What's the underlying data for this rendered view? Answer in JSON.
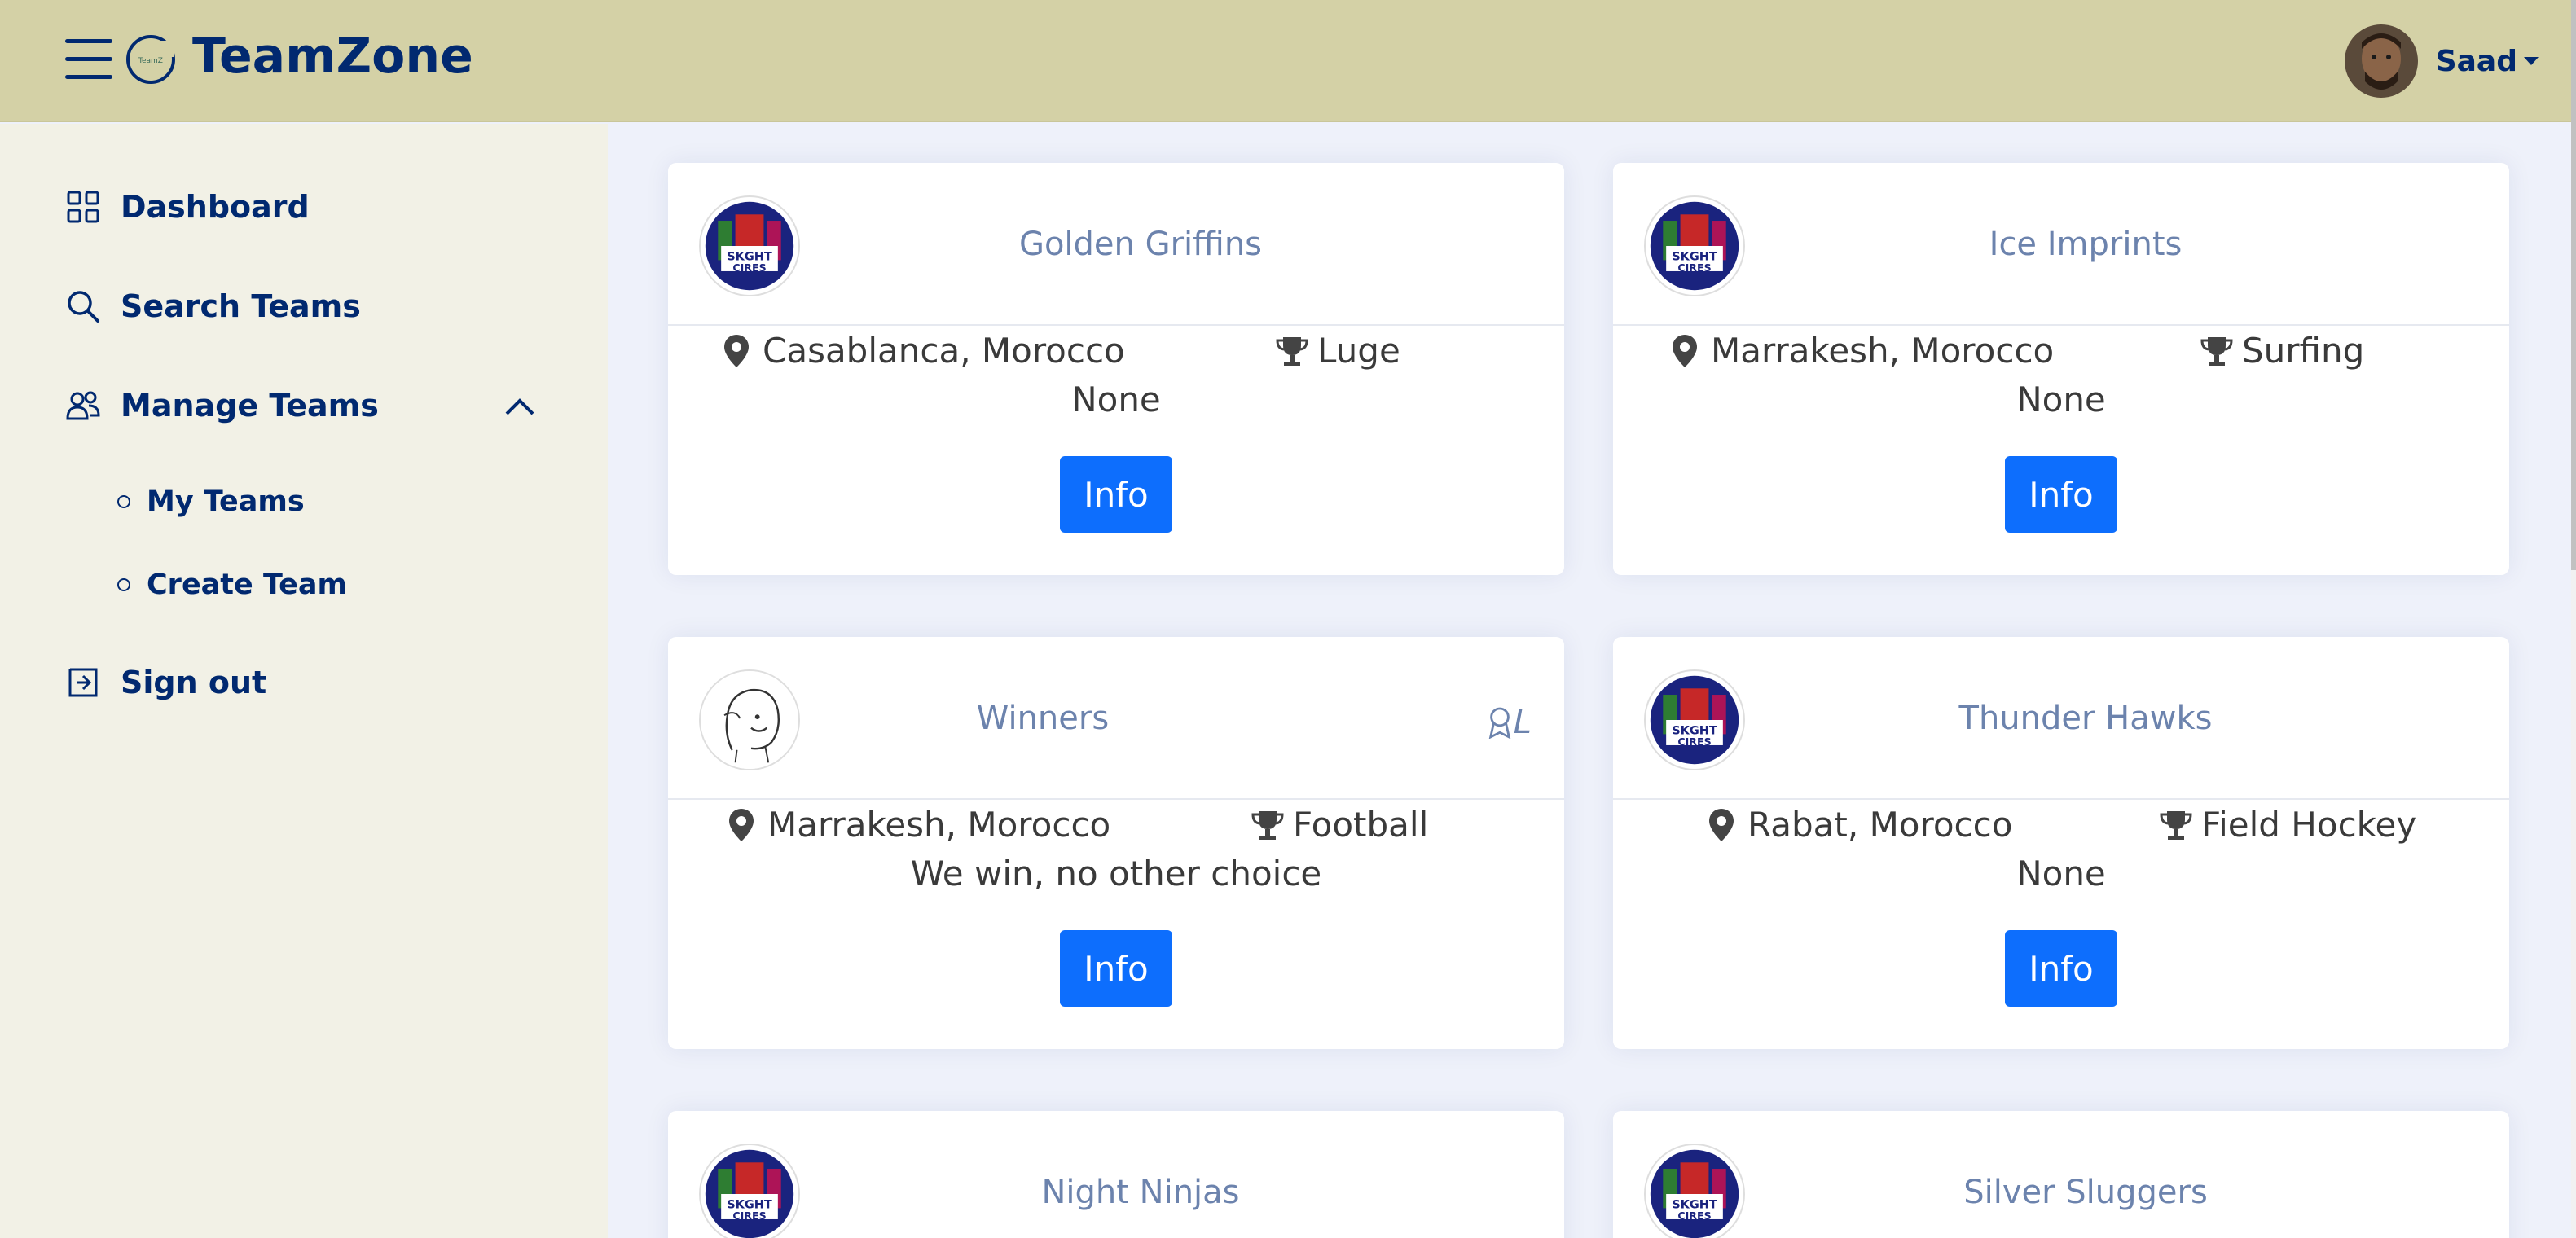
{
  "header": {
    "brand": "TeamZone",
    "user_name": "Saad"
  },
  "sidebar": {
    "items": [
      {
        "label": "Dashboard",
        "icon": "grid-icon"
      },
      {
        "label": "Search Teams",
        "icon": "search-icon"
      },
      {
        "label": "Manage Teams",
        "icon": "people-icon",
        "expanded": true
      },
      {
        "label": "Sign out",
        "icon": "sign-out-icon"
      }
    ],
    "submenu": [
      "My Teams",
      "Create Team"
    ]
  },
  "teams": [
    {
      "name": "Golden Griffins",
      "location": "Casablanca, Morocco",
      "sport": "Luge",
      "description": "None",
      "button": "Info",
      "logo": "team-logo-icon"
    },
    {
      "name": "Ice Imprints",
      "location": "Marrakesh, Morocco",
      "sport": "Surfing",
      "description": "None",
      "button": "Info",
      "logo": "team-logo-icon"
    },
    {
      "name": "Winners",
      "location": "Marrakesh, Morocco",
      "sport": "Football",
      "description": "We win, no other choice",
      "button": "Info",
      "logo": "sketch-face-icon",
      "badge": "L"
    },
    {
      "name": "Thunder Hawks",
      "location": "Rabat, Morocco",
      "sport": "Field Hockey",
      "description": "None",
      "button": "Info",
      "logo": "team-logo-icon"
    },
    {
      "name": "Night Ninjas",
      "logo": "team-logo-icon"
    },
    {
      "name": "Silver Sluggers",
      "logo": "team-logo-icon"
    }
  ],
  "colors": {
    "header_bg": "#d4d1a6",
    "sidebar_bg": "#f2f1e6",
    "content_bg": "#eef1fa",
    "primary_button": "#0d6efd",
    "nav_text": "#012970"
  }
}
